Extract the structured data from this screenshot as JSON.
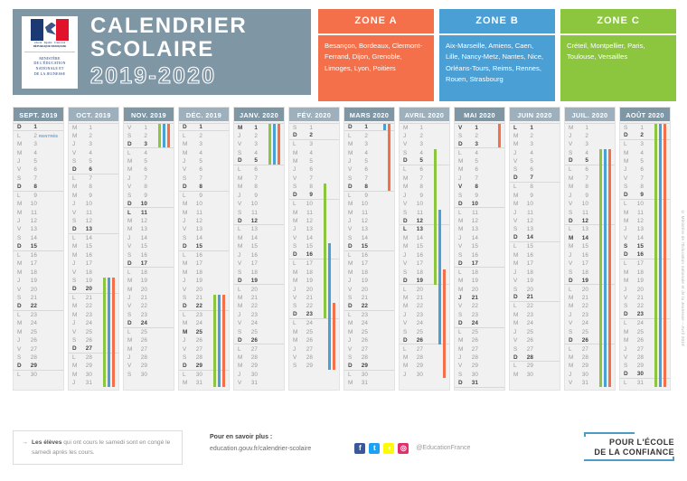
{
  "header": {
    "title": "CALENDRIER SCOLAIRE",
    "years": "2019-2020",
    "logo": {
      "devise": "Liberté · Égalité · Fraternité",
      "republic": "RÉPUBLIQUE FRANÇAISE",
      "ministry": "MINISTÈRE\nDE L'ÉDUCATION\nNATIONALE ET\nDE LA JEUNESSE"
    },
    "bg_color": "#7f96a5"
  },
  "zones": [
    {
      "name": "ZONE A",
      "color": "#f4704a",
      "academies": "Besançon, Bordeaux, Clermont-Ferrand, Dijon, Grenoble, Limoges, Lyon, Poitiers"
    },
    {
      "name": "ZONE B",
      "color": "#4a9fd5",
      "academies": "Aix-Marseille, Amiens, Caen, Lille, Nancy-Metz, Nantes, Nice, Orléans-Tours, Reims, Rennes, Rouen, Strasbourg"
    },
    {
      "name": "ZONE C",
      "color": "#8cc63f",
      "academies": "Créteil, Montpellier, Paris, Toulouse, Versailles"
    }
  ],
  "months": [
    {
      "label": "SEPT. 2019",
      "head_color": "#7f96a5",
      "first_dow_index": 6,
      "days": 30,
      "holidays": [],
      "annotations": {
        "2": "RENTRÉE"
      },
      "bars": []
    },
    {
      "label": "OCT. 2019",
      "head_color": "#9db0bb",
      "first_dow_index": 1,
      "days": 31,
      "holidays": [],
      "annotations": {},
      "bars": [
        {
          "zone": 0,
          "start": 19,
          "end": 31
        },
        {
          "zone": 1,
          "start": 19,
          "end": 31
        },
        {
          "zone": 2,
          "start": 19,
          "end": 31
        }
      ]
    },
    {
      "label": "NOV. 2019",
      "head_color": "#7f96a5",
      "first_dow_index": 4,
      "days": 30,
      "holidays": [
        11
      ],
      "annotations": {},
      "bars": [
        {
          "zone": 0,
          "start": 1,
          "end": 3
        },
        {
          "zone": 1,
          "start": 1,
          "end": 3
        },
        {
          "zone": 2,
          "start": 1,
          "end": 3
        }
      ]
    },
    {
      "label": "DÉC. 2019",
      "head_color": "#9db0bb",
      "first_dow_index": 6,
      "days": 31,
      "holidays": [
        25
      ],
      "annotations": {},
      "bars": [
        {
          "zone": 0,
          "start": 21,
          "end": 31
        },
        {
          "zone": 1,
          "start": 21,
          "end": 31
        },
        {
          "zone": 2,
          "start": 21,
          "end": 31
        }
      ]
    },
    {
      "label": "JANV. 2020",
      "head_color": "#7f96a5",
      "first_dow_index": 2,
      "days": 31,
      "holidays": [
        1
      ],
      "annotations": {},
      "bars": [
        {
          "zone": 0,
          "start": 1,
          "end": 5
        },
        {
          "zone": 1,
          "start": 1,
          "end": 5
        },
        {
          "zone": 2,
          "start": 1,
          "end": 5
        }
      ]
    },
    {
      "label": "FÉV. 2020",
      "head_color": "#9db0bb",
      "first_dow_index": 5,
      "days": 29,
      "holidays": [],
      "annotations": {},
      "bars": [
        {
          "zone": 2,
          "start": 8,
          "end": 23
        },
        {
          "zone": 1,
          "start": 15,
          "end": 29
        },
        {
          "zone": 0,
          "start": 22,
          "end": 29
        }
      ]
    },
    {
      "label": "MARS 2020",
      "head_color": "#7f96a5",
      "first_dow_index": 6,
      "days": 31,
      "holidays": [],
      "annotations": {},
      "bars": [
        {
          "zone": 1,
          "start": 1,
          "end": 1
        },
        {
          "zone": 0,
          "start": 1,
          "end": 8
        }
      ]
    },
    {
      "label": "AVRIL 2020",
      "head_color": "#9db0bb",
      "first_dow_index": 2,
      "days": 30,
      "holidays": [
        13
      ],
      "annotations": {},
      "bars": [
        {
          "zone": 2,
          "start": 4,
          "end": 19
        },
        {
          "zone": 1,
          "start": 11,
          "end": 26
        },
        {
          "zone": 0,
          "start": 18,
          "end": 30
        }
      ]
    },
    {
      "label": "MAI 2020",
      "head_color": "#7f96a5",
      "first_dow_index": 4,
      "days": 31,
      "holidays": [
        1,
        8,
        21
      ],
      "annotations": {},
      "bars": [
        {
          "zone": 0,
          "start": 1,
          "end": 3
        }
      ]
    },
    {
      "label": "JUIN 2020",
      "head_color": "#9db0bb",
      "first_dow_index": 0,
      "days": 30,
      "holidays": [
        1
      ],
      "annotations": {},
      "bars": []
    },
    {
      "label": "JUIL. 2020",
      "head_color": "#9db0bb",
      "first_dow_index": 2,
      "days": 31,
      "holidays": [
        14
      ],
      "annotations": {},
      "bars": [
        {
          "zone": 0,
          "start": 4,
          "end": 31
        },
        {
          "zone": 1,
          "start": 4,
          "end": 31
        },
        {
          "zone": 2,
          "start": 4,
          "end": 31
        }
      ]
    },
    {
      "label": "AOÛT 2020",
      "head_color": "#7f96a5",
      "first_dow_index": 5,
      "days": 31,
      "holidays": [
        15
      ],
      "annotations": {},
      "bars": [
        {
          "zone": 0,
          "start": 1,
          "end": 31
        },
        {
          "zone": 1,
          "start": 1,
          "end": 31
        },
        {
          "zone": 2,
          "start": 1,
          "end": 31
        }
      ]
    }
  ],
  "day_letters": [
    "L",
    "M",
    "M",
    "J",
    "V",
    "S",
    "D"
  ],
  "footer": {
    "note_arrow": "→",
    "note_bold": "Les élèves",
    "note_rest": " qui ont cours le samedi sont en congé le samedi après les cours.",
    "savoir_title": "Pour en savoir plus :",
    "savoir_url": "education.gouv.fr/calendrier-scolaire",
    "handle": "@EducationFrance",
    "socials": [
      {
        "name": "facebook-icon",
        "glyph": "f",
        "color": "#3b5998"
      },
      {
        "name": "twitter-icon",
        "glyph": "t",
        "color": "#1da1f2"
      },
      {
        "name": "snapchat-icon",
        "glyph": "◑",
        "color": "#fffc00"
      },
      {
        "name": "instagram-icon",
        "glyph": "◎",
        "color": "#e1306c"
      }
    ],
    "confiance_line1": "POUR L'ÉCOLE",
    "confiance_line2": "DE LA CONFIANCE",
    "copyright": "© Ministère de l'Éducation nationale et de la Jeunesse – Avril 2019"
  }
}
